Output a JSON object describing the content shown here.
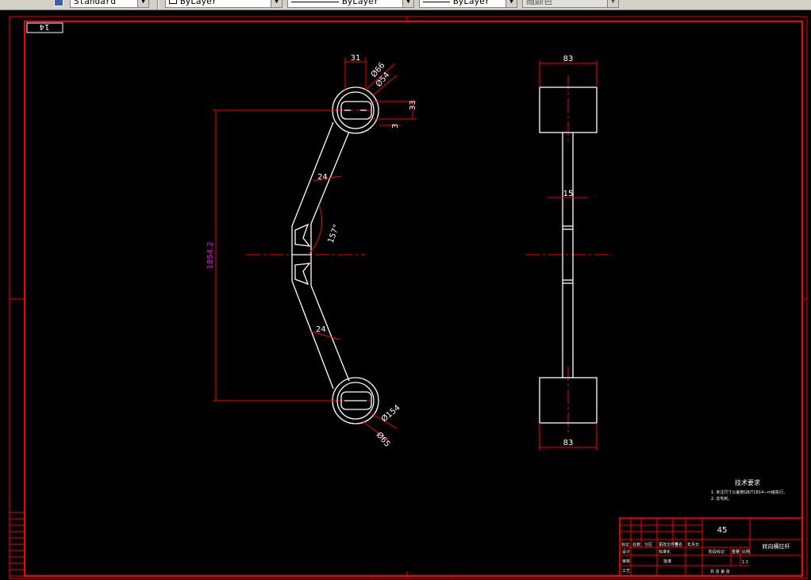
{
  "toolbar": {
    "text_style": "Standard",
    "layer": "ByLayer",
    "linetype": "ByLayer",
    "lineweight": "ByLayer",
    "plot_style": "随颜色"
  },
  "drawing": {
    "sheet_code": "14",
    "front_view": {
      "dim_top_width": "31",
      "dim_outer_dia_top": "Ø66",
      "dim_inner_dia_top": "Ø54",
      "dim_slot_height": "33",
      "dim_slot_small": "3",
      "dim_arm_width_top": "24",
      "dim_angle": "157°",
      "dim_overall_height": "1854.2",
      "dim_arm_width_bottom": "24",
      "dim_inner_dia_bottom": "Ø154",
      "dim_outer_dia_bottom": "Ø65"
    },
    "side_view": {
      "dim_top_width": "83",
      "dim_web": "15",
      "dim_bottom_width": "83"
    },
    "notes": {
      "title": "技术要求",
      "line1": "1. 未注尺寸公差按GB/T1814—m级执行。",
      "line2": "2. 去毛刺。"
    },
    "title_block": {
      "material": "45",
      "part_name": "转向横拉杆",
      "scale": "1:1",
      "row_labels": [
        "标记",
        "处数",
        "分区",
        "更改文件号",
        "签名",
        "年月日"
      ],
      "designer": "设计",
      "standardize": "标准化",
      "stage_mark": "阶段标记",
      "weight": "重量",
      "ratio": "比例",
      "review": "审核",
      "process": "工艺",
      "approve": "批准",
      "sheets": "共 张 第 张"
    },
    "colors": {
      "frame": "#ff0000",
      "geometry": "#ffffff",
      "dimension": "#ff0000",
      "vertical_dim_text": "#ff00ff",
      "background": "#000000"
    }
  }
}
